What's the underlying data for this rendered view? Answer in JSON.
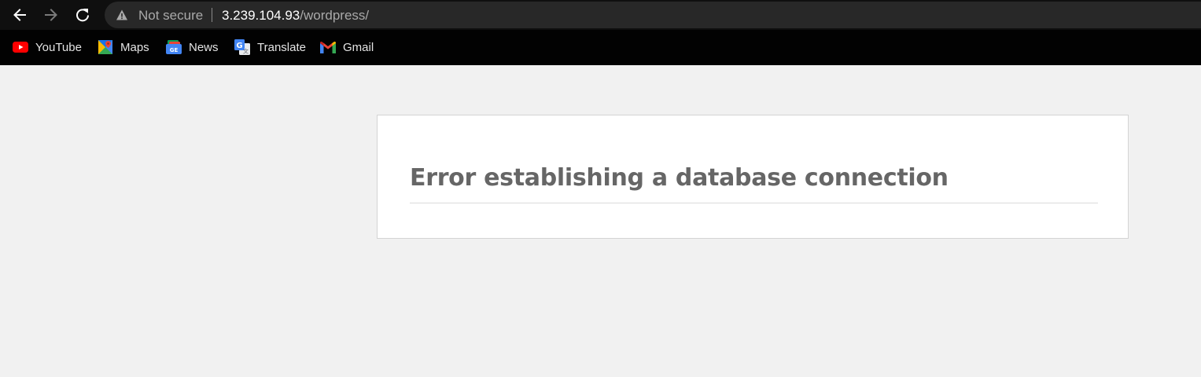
{
  "browser": {
    "nav": {
      "back_icon": "arrow-left-icon",
      "forward_icon": "arrow-right-icon",
      "reload_icon": "reload-icon"
    },
    "omnibox": {
      "security_icon": "warning-triangle-icon",
      "security_label": "Not secure",
      "url_host": "3.239.104.93",
      "url_path": "/wordpress/"
    },
    "bookmarks": [
      {
        "label": "YouTube",
        "icon": "youtube-icon"
      },
      {
        "label": "Maps",
        "icon": "maps-icon"
      },
      {
        "label": "News",
        "icon": "news-icon"
      },
      {
        "label": "Translate",
        "icon": "translate-icon"
      },
      {
        "label": "Gmail",
        "icon": "gmail-icon"
      }
    ]
  },
  "page": {
    "error_title": "Error establishing a database connection"
  },
  "colors": {
    "toolbar_bg": "#0f0f0f",
    "omnibox_bg": "#282828",
    "page_bg": "#f1f1f1",
    "error_text": "#666666"
  }
}
